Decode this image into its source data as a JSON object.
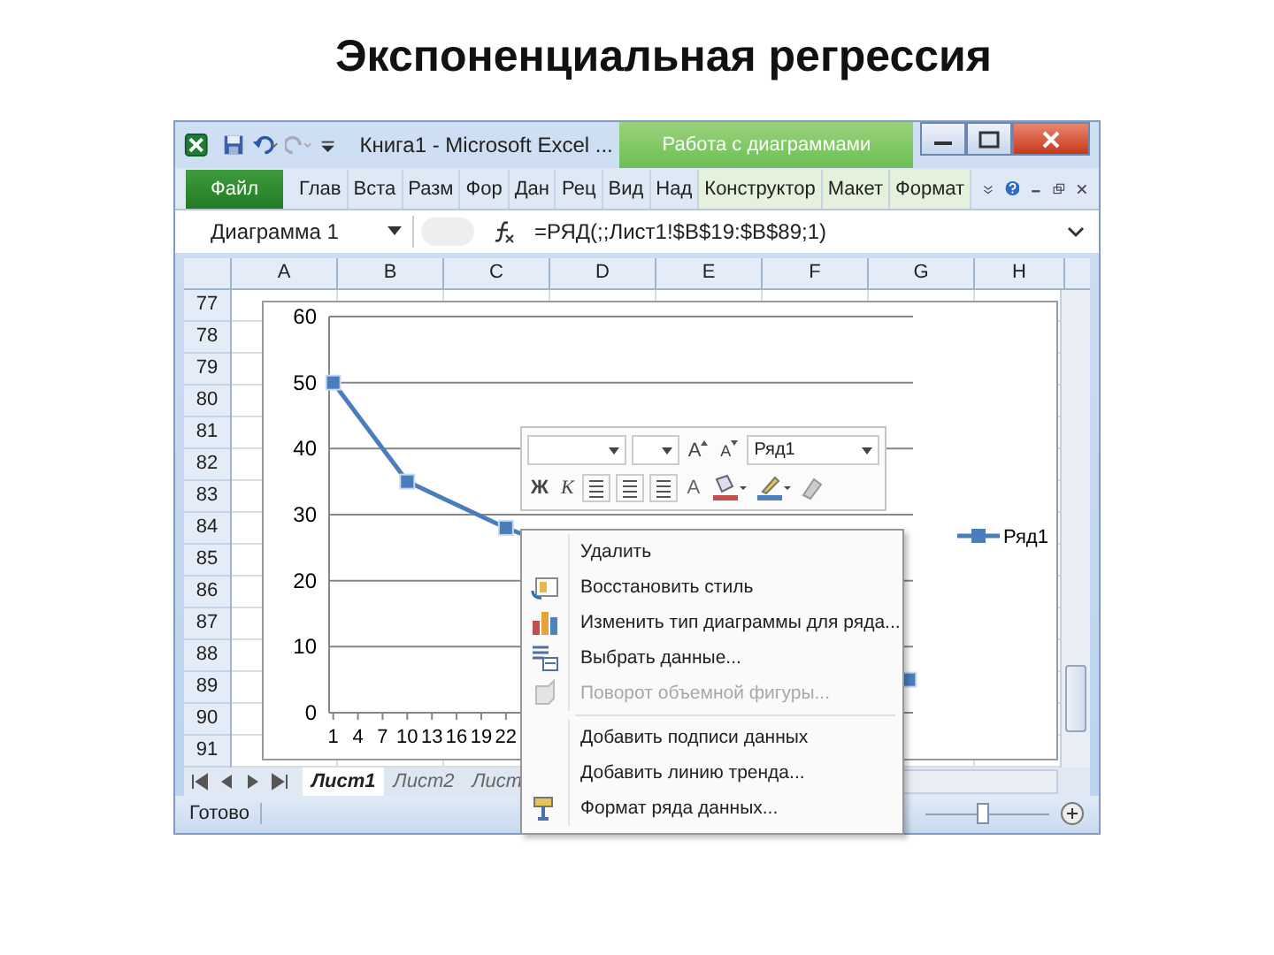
{
  "slide_title": "Экспоненциальная регрессия",
  "window": {
    "title": "Книга1 - Microsoft Excel ...",
    "context_group": "Работа с диаграммами"
  },
  "ribbon_tabs": [
    {
      "label": "Файл",
      "kind": "file"
    },
    {
      "label": "Глав",
      "kind": "tab"
    },
    {
      "label": "Вста",
      "kind": "tab"
    },
    {
      "label": "Разм",
      "kind": "tab"
    },
    {
      "label": "Фор",
      "kind": "tab"
    },
    {
      "label": "Дан",
      "kind": "tab"
    },
    {
      "label": "Рец",
      "kind": "tab"
    },
    {
      "label": "Вид",
      "kind": "tab"
    },
    {
      "label": "Над",
      "kind": "tab"
    },
    {
      "label": "Конструктор",
      "kind": "context"
    },
    {
      "label": "Макет",
      "kind": "context"
    },
    {
      "label": "Формат",
      "kind": "context"
    }
  ],
  "name_box": "Диаграмма 1",
  "formula": "=РЯД(;;Лист1!$B$19:$B$89;1)",
  "columns": [
    "A",
    "B",
    "C",
    "D",
    "E",
    "F",
    "G",
    "H"
  ],
  "rows": [
    "77",
    "78",
    "79",
    "80",
    "81",
    "82",
    "83",
    "84",
    "85",
    "86",
    "87",
    "88",
    "89",
    "90",
    "91"
  ],
  "chart": {
    "chart_data": {
      "type": "line",
      "x": [
        1,
        10,
        22,
        71
      ],
      "grid": true,
      "series": [
        {
          "name": "Ряд1",
          "color": "#4a7ebb",
          "marker": "square",
          "values": [
            50,
            35,
            28,
            5
          ]
        }
      ],
      "xlim": [
        0.5,
        71.5
      ],
      "ylim": [
        0,
        60
      ],
      "xticks": [
        1,
        4,
        7,
        10,
        13,
        16,
        19,
        22
      ],
      "yticks": [
        0,
        10,
        20,
        30,
        40,
        50,
        60
      ]
    }
  },
  "mini_toolbar": {
    "series_box": "Ряд1",
    "grow_font": "A",
    "shrink_font": "A",
    "bold": "Ж",
    "italic": "К",
    "font_color": "A"
  },
  "context_menu": [
    {
      "kind": "item",
      "label": "Удалить",
      "disabled": false
    },
    {
      "kind": "item",
      "label": "Восстановить стиль",
      "disabled": false
    },
    {
      "kind": "item",
      "label": "Изменить тип диаграммы для ряда...",
      "disabled": false
    },
    {
      "kind": "item",
      "label": "Выбрать данные...",
      "disabled": false
    },
    {
      "kind": "item",
      "label": "Поворот объемной фигуры...",
      "disabled": true
    },
    {
      "kind": "separator"
    },
    {
      "kind": "item",
      "label": "Добавить подписи данных",
      "disabled": false
    },
    {
      "kind": "item",
      "label": "Добавить линию тренда...",
      "disabled": false
    },
    {
      "kind": "item",
      "label": "Формат ряда данных...",
      "disabled": false
    }
  ],
  "sheet_tabs": [
    {
      "label": "Лист1",
      "selected": true
    },
    {
      "label": "Лист2",
      "selected": false
    },
    {
      "label": "Лист",
      "selected": false
    }
  ],
  "status_bar": {
    "text": "Готово"
  },
  "zoom": {
    "level": 0.45
  }
}
